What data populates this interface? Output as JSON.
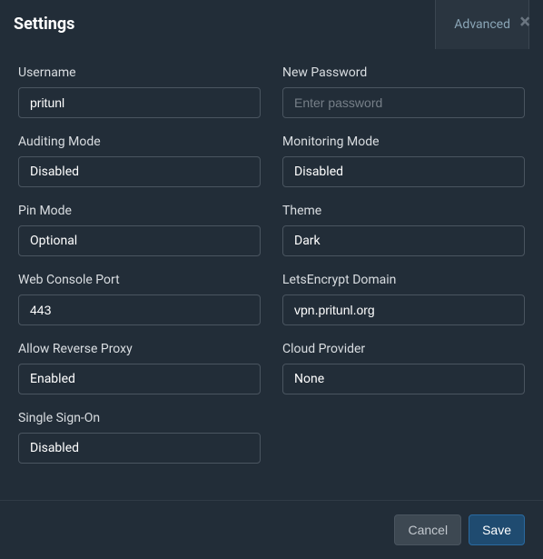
{
  "header": {
    "title": "Settings",
    "tab_advanced": "Advanced",
    "close_glyph": "×"
  },
  "left": {
    "username_label": "Username",
    "username_value": "pritunl",
    "auditing_label": "Auditing Mode",
    "auditing_value": "Disabled",
    "pin_label": "Pin Mode",
    "pin_value": "Optional",
    "port_label": "Web Console Port",
    "port_value": "443",
    "proxy_label": "Allow Reverse Proxy",
    "proxy_value": "Enabled",
    "sso_label": "Single Sign-On",
    "sso_value": "Disabled"
  },
  "right": {
    "password_label": "New Password",
    "password_placeholder": "Enter password",
    "monitoring_label": "Monitoring Mode",
    "monitoring_value": "Disabled",
    "theme_label": "Theme",
    "theme_value": "Dark",
    "le_label": "LetsEncrypt Domain",
    "le_value": "vpn.pritunl.org",
    "cloud_label": "Cloud Provider",
    "cloud_value": "None"
  },
  "footer": {
    "cancel": "Cancel",
    "save": "Save"
  }
}
